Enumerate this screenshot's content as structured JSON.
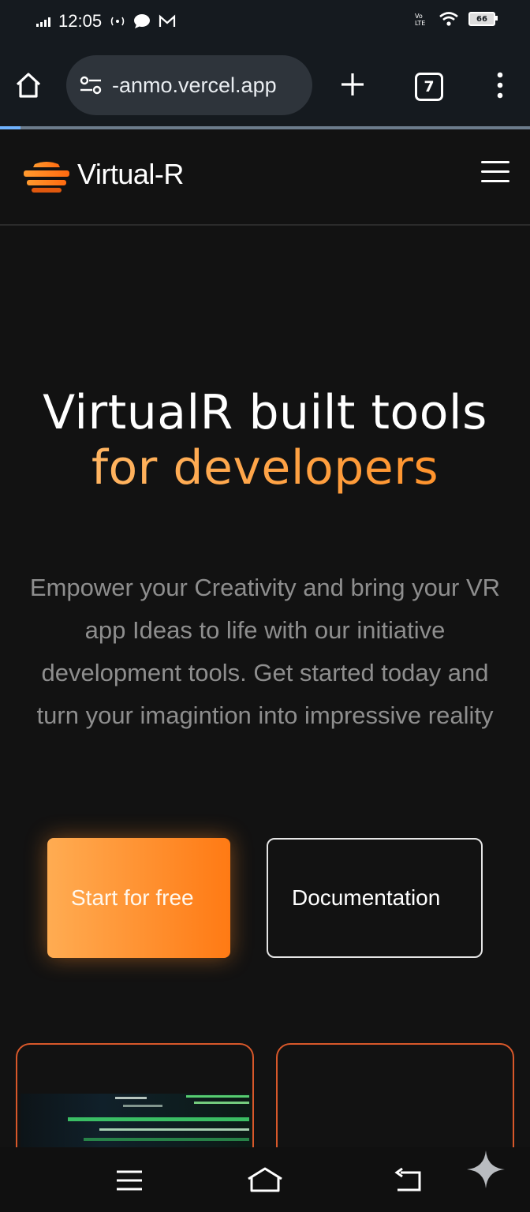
{
  "status_bar": {
    "time": "12:05",
    "battery": "66"
  },
  "browser": {
    "url": "-anmo.vercel.app",
    "tab_count": "7"
  },
  "site": {
    "brand": "Virtual-R"
  },
  "hero": {
    "title_line1": "VirtualR built tools",
    "title_line2": "for developers",
    "description": "Empower your Creativity and bring your VR app Ideas to life with our initiative development tools. Get started today and turn your imagintion into impressive reality",
    "primary_button": "Start for free",
    "secondary_button": "Documentation"
  },
  "colors": {
    "accent": "#ff8a1e",
    "card_border": "#d8582a",
    "background": "#121212"
  },
  "icons": [
    "home-icon",
    "site-settings-icon",
    "plus-icon",
    "tabs-icon",
    "more-vert-icon",
    "menu-icon",
    "sparkle-icon"
  ]
}
